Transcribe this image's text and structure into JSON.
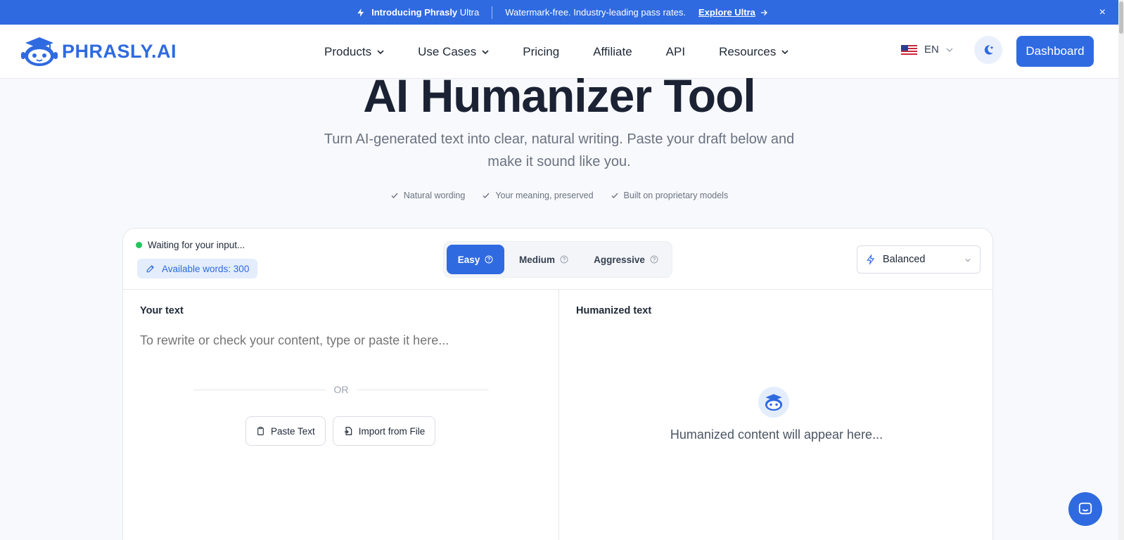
{
  "announcement": {
    "intro_bold": "Introducing Phrasly",
    "intro_rest": "Ultra",
    "tagline": "Watermark-free. Industry-leading pass rates.",
    "cta": "Explore Ultra",
    "close": "×",
    "bg_color": "#2f6ae0"
  },
  "nav": {
    "logo_text": "PHRASLY.AI",
    "links": [
      {
        "label": "Products",
        "dropdown": true
      },
      {
        "label": "Use Cases",
        "dropdown": true
      },
      {
        "label": "Pricing",
        "dropdown": false
      },
      {
        "label": "Affiliate",
        "dropdown": false
      },
      {
        "label": "API",
        "dropdown": false
      },
      {
        "label": "Resources",
        "dropdown": true
      }
    ],
    "language": "EN",
    "dashboard": "Dashboard"
  },
  "hero": {
    "title": "AI Humanizer Tool",
    "subtitle": "Turn AI-generated text into clear, natural writing. Paste your draft below and make it sound like you.",
    "features": [
      "Natural wording",
      "Your meaning, preserved",
      "Built on proprietary models"
    ]
  },
  "tool": {
    "status": "Waiting for your input...",
    "available_words": "Available words: 300",
    "modes": [
      {
        "label": "Easy",
        "active": true
      },
      {
        "label": "Medium",
        "active": false
      },
      {
        "label": "Aggressive",
        "active": false
      }
    ],
    "style_select": "Balanced",
    "input_label": "Your text",
    "input_placeholder": "To rewrite or check your content, type or paste it here...",
    "or": "OR",
    "paste_button": "Paste Text",
    "import_button": "Import from File",
    "output_label": "Humanized text",
    "output_placeholder": "Humanized content will appear here..."
  },
  "colors": {
    "accent": "#2f6ae0",
    "status_dot": "#22c55e"
  }
}
